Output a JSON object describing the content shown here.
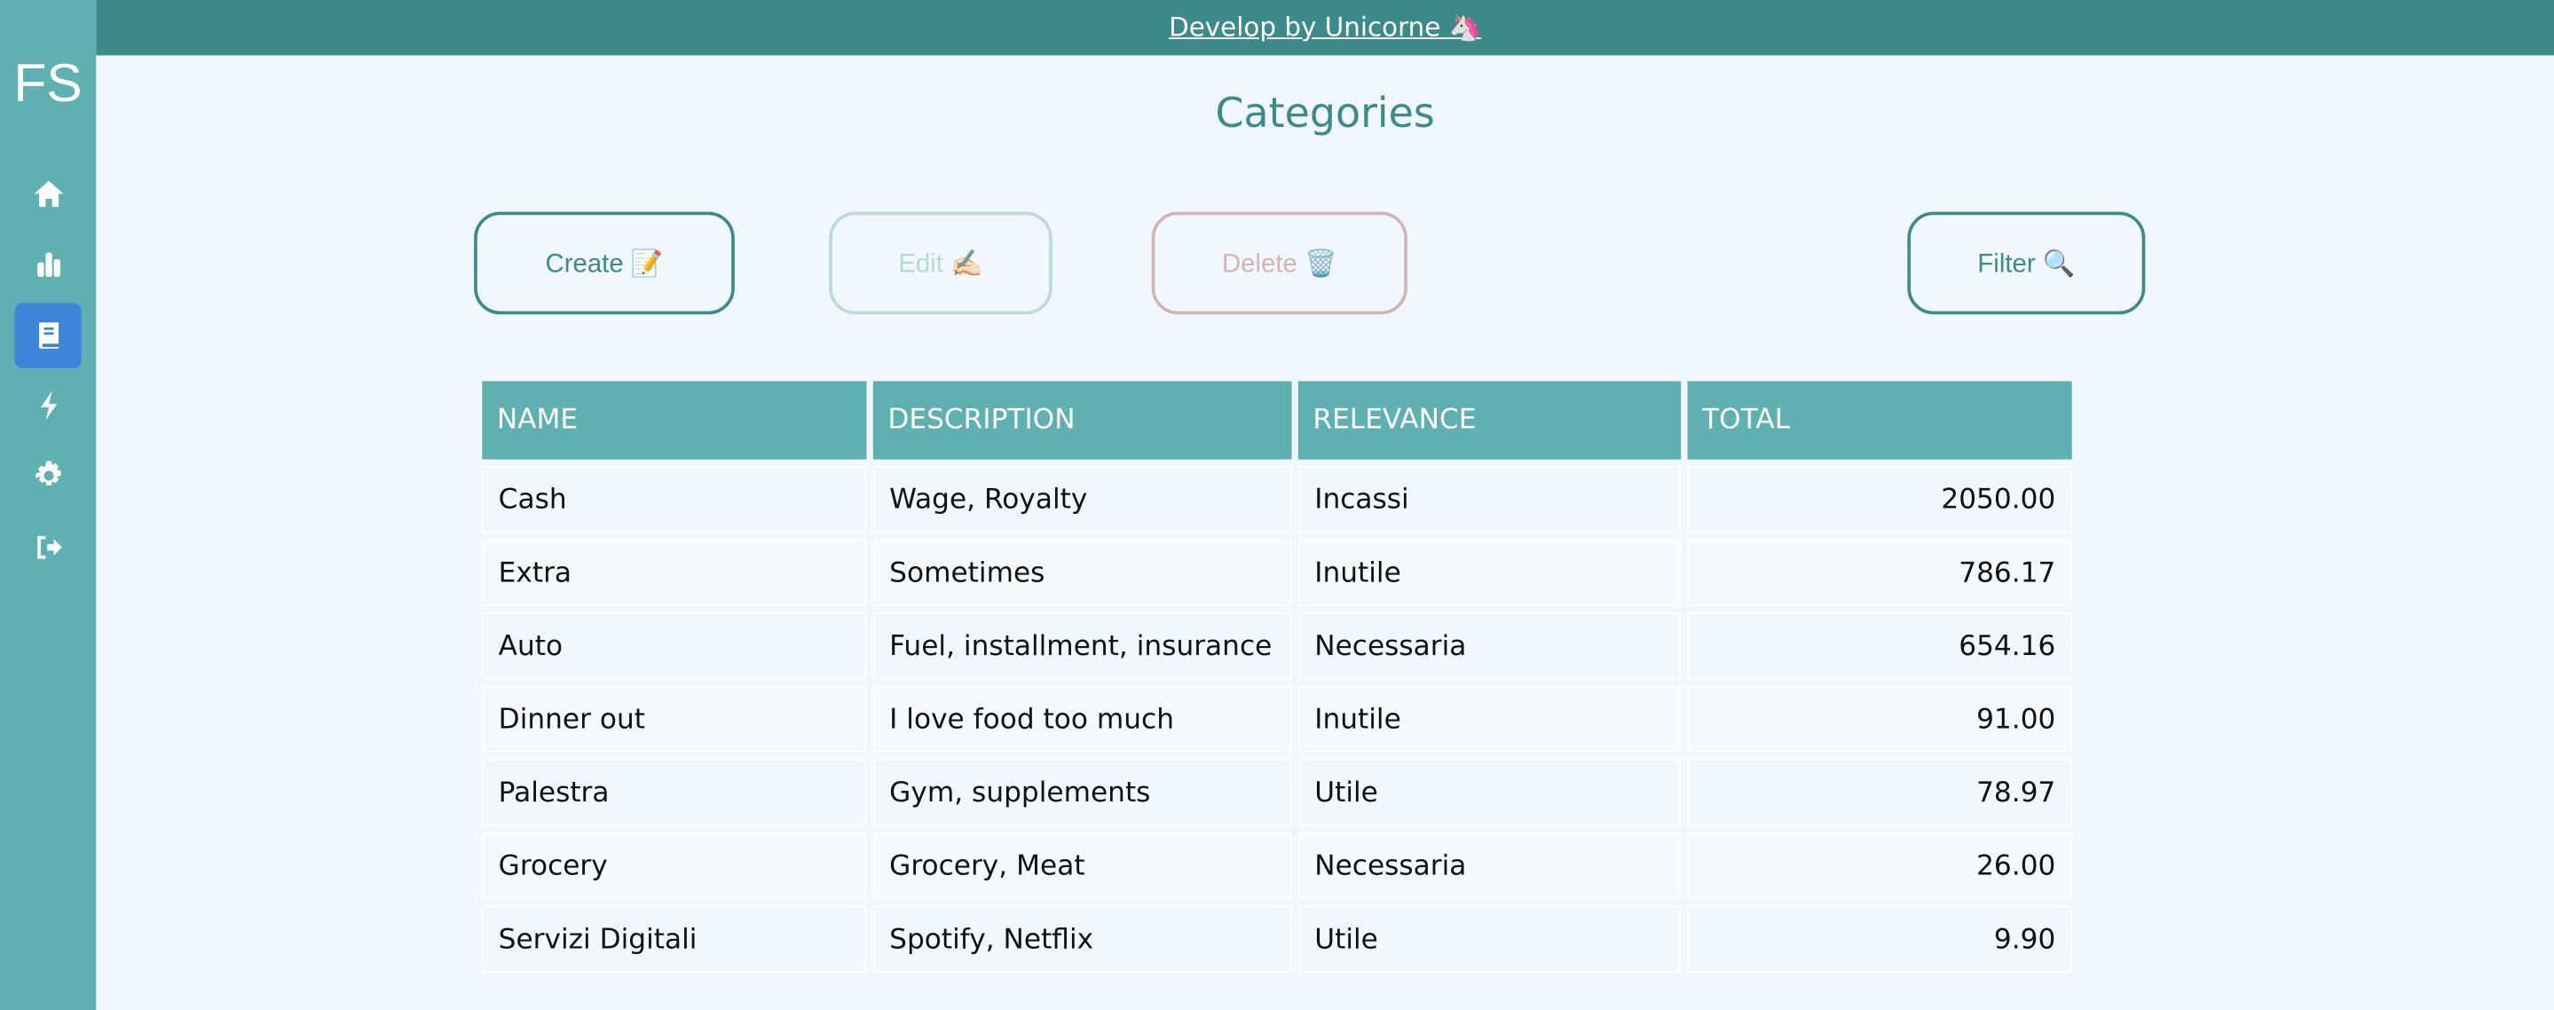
{
  "sidebar": {
    "logo": "FS",
    "items": [
      {
        "icon": "home-icon",
        "active": false
      },
      {
        "icon": "bar-chart-icon",
        "active": false
      },
      {
        "icon": "book-icon",
        "active": true
      },
      {
        "icon": "bolt-icon",
        "active": false
      },
      {
        "icon": "gear-icon",
        "active": false
      },
      {
        "icon": "sign-out-icon",
        "active": false
      }
    ]
  },
  "topbar": {
    "credit": "Develop by Unicorne 🦄"
  },
  "page": {
    "title": "Categories"
  },
  "toolbar": {
    "create": "Create 📝",
    "edit": "Edit ✍🏻",
    "delete": "Delete 🗑️",
    "filter": "Filter 🔍"
  },
  "table": {
    "headers": [
      "NAME",
      "DESCRIPTION",
      "RELEVANCE",
      "TOTAL"
    ],
    "rows": [
      [
        "Cash",
        "Wage, Royalty",
        "Incassi",
        "2050.00"
      ],
      [
        "Extra",
        "Sometimes",
        "Inutile",
        "786.17"
      ],
      [
        "Auto",
        "Fuel, installment, insurance",
        "Necessaria",
        "654.16"
      ],
      [
        "Dinner out",
        "I love food too much",
        "Inutile",
        "91.00"
      ],
      [
        "Palestra",
        "Gym, supplements",
        "Utile",
        "78.97"
      ],
      [
        "Grocery",
        "Grocery, Meat",
        "Necessaria",
        "26.00"
      ],
      [
        "Servizi Digitali",
        "Spotify, Netflix",
        "Utile",
        "9.90"
      ]
    ]
  },
  "colors": {
    "sidebar": "#5eb0b1",
    "topbar": "#3c8a8a",
    "active": "#3d85d9",
    "background": "#f1f8fd"
  }
}
